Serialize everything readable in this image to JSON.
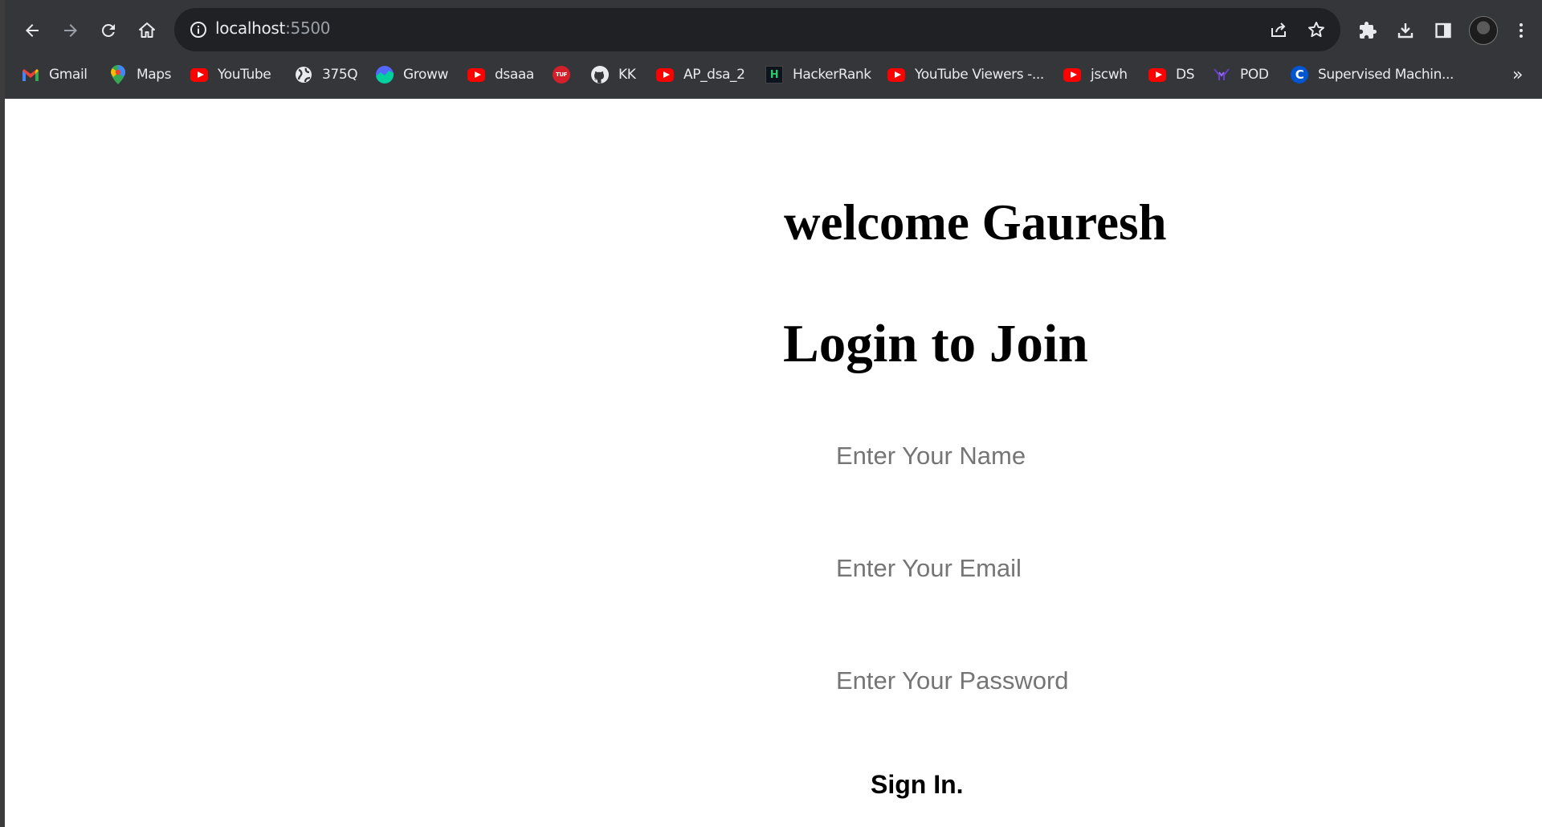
{
  "browser": {
    "url_host": "localhost",
    "url_port": ":5500",
    "bookmarks": [
      {
        "label": "Gmail",
        "icon": "gmail-icon"
      },
      {
        "label": "Maps",
        "icon": "maps-icon"
      },
      {
        "label": "YouTube",
        "icon": "youtube-icon"
      },
      {
        "label": "375Q",
        "icon": "globe-icon"
      },
      {
        "label": "Groww",
        "icon": "groww-icon"
      },
      {
        "label": "dsaaa",
        "icon": "youtube-icon"
      },
      {
        "label": "",
        "icon": "tuf-icon",
        "icon_text": "TUF"
      },
      {
        "label": "KK",
        "icon": "github-icon"
      },
      {
        "label": "AP_dsa_2",
        "icon": "youtube-icon"
      },
      {
        "label": "HackerRank",
        "icon": "hackerrank-icon",
        "icon_text": "H"
      },
      {
        "label": "YouTube Viewers -...",
        "icon": "youtube-icon"
      },
      {
        "label": "jscwh",
        "icon": "youtube-icon"
      },
      {
        "label": "DS",
        "icon": "youtube-icon"
      },
      {
        "label": "POD",
        "icon": "pod-icon"
      },
      {
        "label": "Supervised Machin...",
        "icon": "coursera-icon",
        "icon_text": "C"
      }
    ],
    "more_bookmarks": "»"
  },
  "page": {
    "welcome": "welcome Gauresh",
    "title": "Login to Join",
    "name_placeholder": "Enter Your Name",
    "email_placeholder": "Enter Your Email",
    "password_placeholder": "Enter Your Password",
    "submit_label": "Sign In."
  },
  "colors": {
    "chrome_bg": "#35363a",
    "omnibox_bg": "#202124",
    "youtube_red": "#ff0000",
    "placeholder": "#757575"
  }
}
